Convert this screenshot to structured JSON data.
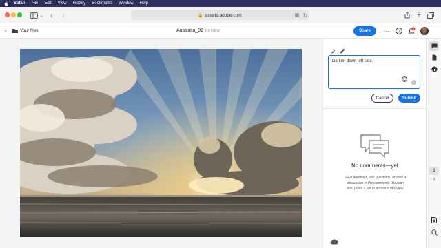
{
  "menubar": {
    "items": [
      "Safari",
      "File",
      "Edit",
      "View",
      "History",
      "Bookmarks",
      "Window",
      "Help"
    ]
  },
  "browser": {
    "url": "assets.adobe.com"
  },
  "header": {
    "breadcrumb": "Your files",
    "title": "Australia_01",
    "mode_label": "REVIEW",
    "share_label": "Share",
    "notification_count": "1"
  },
  "comment": {
    "text": "Darken down left side.",
    "cancel_label": "Cancel",
    "submit_label": "Submit"
  },
  "empty_state": {
    "title": "No comments—yet",
    "description": "Give feedback, ask questions, or start a discussion in the comments. You can also place a pin to annotate this view."
  },
  "pager": {
    "current": "1",
    "total": "1"
  },
  "colors": {
    "accent": "#1473e6",
    "menubar": "#2b2f5e"
  },
  "icons": [
    "apple-icon",
    "sidebar-icon",
    "back-icon",
    "forward-icon",
    "lock-icon",
    "translate-icon",
    "reload-icon",
    "share-icon",
    "new-tab-icon",
    "tab-overview-icon",
    "folder-icon",
    "more-icon",
    "help-icon",
    "bell-icon",
    "pin-icon",
    "pencil-icon",
    "emoji-icon",
    "at-icon",
    "chat-bubble-icon",
    "cloud-icon",
    "comment-icon",
    "info-icon",
    "file-icon"
  ]
}
